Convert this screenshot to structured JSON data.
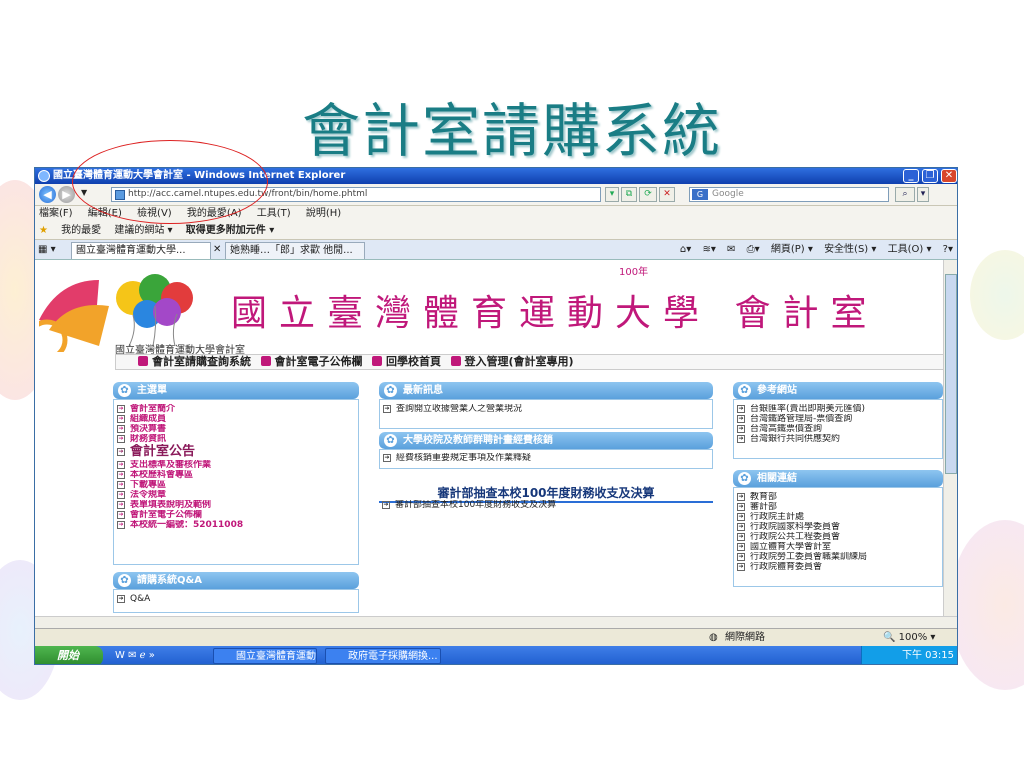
{
  "slide": {
    "title": "會計室請購系統"
  },
  "browser": {
    "window_title": "國立臺灣體育運動大學會計室 - Windows Internet Explorer",
    "url": "http://acc.camel.ntupes.edu.tw/front/bin/home.phtml",
    "search_placeholder": "Google",
    "menu": [
      "檔案(F)",
      "編輯(E)",
      "檢視(V)",
      "我的最愛(A)",
      "工具(T)",
      "說明(H)"
    ],
    "favorites": [
      "我的最愛",
      "建議的網站 ▾",
      "取得更多附加元件 ▾"
    ],
    "tabs": [
      "國立臺灣體育運動大學...",
      "她熟睡…「郎」求歡 他閒..."
    ],
    "commands": [
      "網頁(P) ▾",
      "安全性(S) ▾",
      "工具(O) ▾"
    ],
    "status": {
      "zone": "網際網路",
      "zoom": "100%"
    }
  },
  "taskbar": {
    "start": "開始",
    "items": [
      "國立臺灣體育運動...",
      "政府電子採購網換..."
    ],
    "clock": "下午 03:15"
  },
  "page": {
    "year_badge": "100年",
    "univ_name": "國立臺灣體育運動大學 會計室",
    "site_line": "國立臺灣體育運動大學會計室",
    "nav": [
      "會計室請購查詢系統",
      "會計室電子公佈欄",
      "回學校首頁",
      "登入管理(會計室專用)"
    ],
    "left_panel": {
      "title": "主選單",
      "items": [
        "會計室簡介",
        "組織成員",
        "預決算書",
        "財務資訊"
      ],
      "section": "會計室公告",
      "items2": [
        "支出標準及審核作業",
        "本校歷科會專區",
        "下載專區",
        "法令規章",
        "表單填表說明及範例",
        "會計室電子公佈欄",
        "本校統一編號：52011008"
      ]
    },
    "qa_panel": {
      "title": "請購系統Q&A",
      "items": [
        "Q&A"
      ]
    },
    "news_panel": {
      "title": "最新訊息",
      "items": [
        "查詢開立收據營業人之營業現況"
      ]
    },
    "plan_panel": {
      "title": "大學校院及教師群聘計畫經費核銷",
      "items": [
        "經費核銷重要規定事項及作業釋疑"
      ]
    },
    "audit_heading": "審計部抽查本校100年度財務收支及決算",
    "audit_items": [
      "審計部抽查本校100年度財務收支及決算"
    ],
    "ref_panel": {
      "title": "參考網站",
      "items": [
        "台銀匯率(賣出即期美元匯價)",
        "台灣鐵路管理局-票價查詢",
        "台灣高鐵票價查詢",
        "台灣銀行共同供應契約"
      ]
    },
    "rel_panel": {
      "title": "相關連結",
      "items": [
        "教育部",
        "審計部",
        "行政院主計處",
        "行政院國家科學委員會",
        "行政院公共工程委員會",
        "國立體育大學會計室",
        "行政院勞工委員會職業訓練局",
        "行政院體育委員會"
      ]
    }
  }
}
